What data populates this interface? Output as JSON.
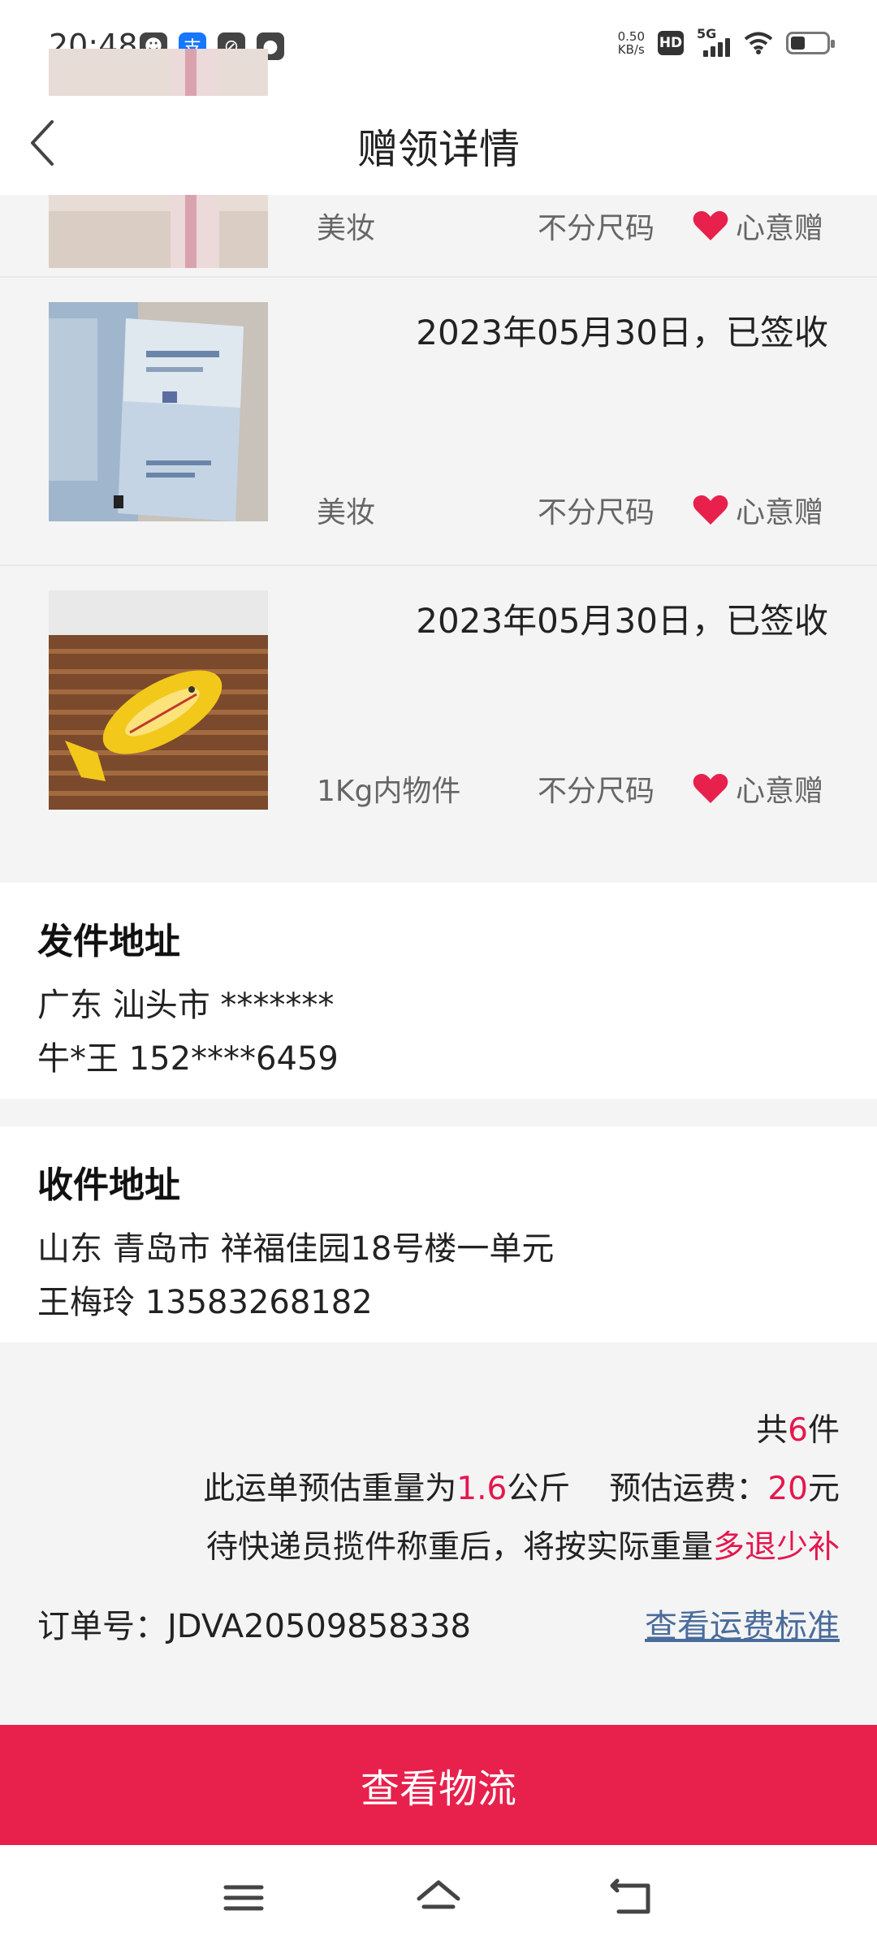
{
  "status_bar": {
    "time": "20:48",
    "net_speed_value": "0.50",
    "net_speed_unit": "KB/s",
    "hd_label": "HD",
    "network_label": "5G",
    "battery_level": 0.4
  },
  "header": {
    "title": "赠领详情"
  },
  "items": [
    {
      "date_status": "",
      "category": "美妆",
      "size": "不分尺码",
      "gift_type": "心意赠"
    },
    {
      "date_status": "2023年05月30日，已签收",
      "category": "美妆",
      "size": "不分尺码",
      "gift_type": "心意赠"
    },
    {
      "date_status": "2023年05月30日，已签收",
      "category": "1Kg内物件",
      "size": "不分尺码",
      "gift_type": "心意赠"
    }
  ],
  "sender": {
    "title": "发件地址",
    "address": "广东 汕头市 *******",
    "contact": "牛*王 152****6459"
  },
  "receiver": {
    "title": "收件地址",
    "address": "山东 青岛市 祥福佳园18号楼一单元",
    "contact": "王梅玲 13583268182"
  },
  "summary": {
    "count_prefix": "共",
    "count_value": "6",
    "count_suffix": "件",
    "weight_prefix": "此运单预估重量为",
    "weight_value": "1.6",
    "weight_unit": "公斤",
    "fee_label": "预估运费：",
    "fee_value": "20",
    "fee_unit": "元",
    "note_prefix": "待快递员揽件称重后，将按实际重量",
    "note_accent": "多退少补",
    "order_label": "订单号：",
    "order_number": "JDVA20509858338",
    "fee_standard_link": "查看运费标准"
  },
  "bottom_button": {
    "label": "查看物流"
  },
  "colors": {
    "accent": "#e5174d",
    "button": "#e8204c",
    "link": "#4a6c9b",
    "heart": "#e8204c"
  },
  "icons": {
    "back": "chevron-left-icon",
    "heart": "heart-icon",
    "nav_menu": "menu-icon",
    "nav_home": "home-icon",
    "nav_back": "return-icon"
  }
}
